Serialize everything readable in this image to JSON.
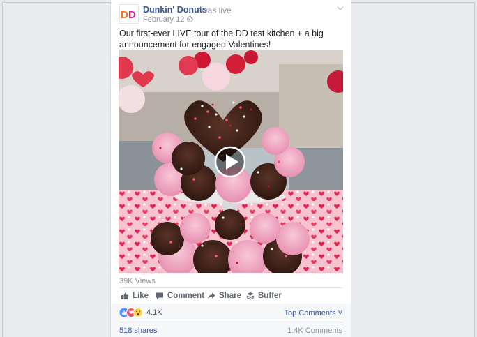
{
  "post": {
    "page_name": "Dunkin' Donuts",
    "action": "was live.",
    "date": "February 12 ·",
    "text": "Our first-ever LIVE tour of the DD test kitchen + a big announcement for engaged Valentines!",
    "avatar_text": "DD",
    "avatar_icon": "dunkin-logo-icon",
    "privacy_icon": "globe-icon",
    "menu_icon": "chevron-down-icon"
  },
  "video": {
    "play_icon": "play-icon",
    "views": "39K Views"
  },
  "actions": {
    "like": "Like",
    "comment": "Comment",
    "share": "Share",
    "buffer": "Buffer"
  },
  "stats": {
    "reactions_count": "4.1K",
    "top_comments": "Top Comments ˅",
    "shares": "518 shares",
    "comments": "1.4K Comments"
  },
  "colors": {
    "link": "#365899",
    "muted": "#90949c",
    "dunkin_orange": "#ff6e1b",
    "dunkin_pink": "#e0218a"
  }
}
